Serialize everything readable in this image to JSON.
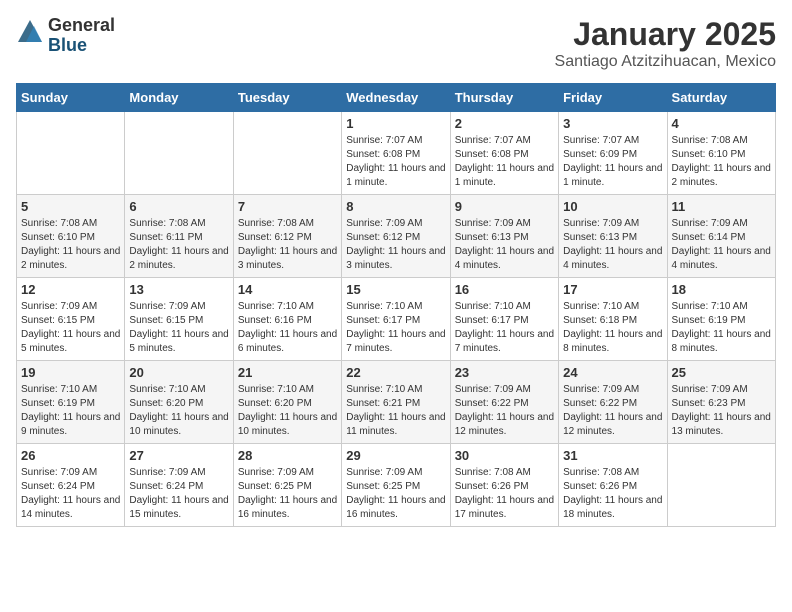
{
  "logo": {
    "general": "General",
    "blue": "Blue"
  },
  "title": "January 2025",
  "location": "Santiago Atzitzihuacan, Mexico",
  "days_of_week": [
    "Sunday",
    "Monday",
    "Tuesday",
    "Wednesday",
    "Thursday",
    "Friday",
    "Saturday"
  ],
  "weeks": [
    [
      {
        "day": "",
        "info": ""
      },
      {
        "day": "",
        "info": ""
      },
      {
        "day": "",
        "info": ""
      },
      {
        "day": "1",
        "sunrise": "Sunrise: 7:07 AM",
        "sunset": "Sunset: 6:08 PM",
        "daylight": "Daylight: 11 hours and 1 minute."
      },
      {
        "day": "2",
        "sunrise": "Sunrise: 7:07 AM",
        "sunset": "Sunset: 6:08 PM",
        "daylight": "Daylight: 11 hours and 1 minute."
      },
      {
        "day": "3",
        "sunrise": "Sunrise: 7:07 AM",
        "sunset": "Sunset: 6:09 PM",
        "daylight": "Daylight: 11 hours and 1 minute."
      },
      {
        "day": "4",
        "sunrise": "Sunrise: 7:08 AM",
        "sunset": "Sunset: 6:10 PM",
        "daylight": "Daylight: 11 hours and 2 minutes."
      }
    ],
    [
      {
        "day": "5",
        "sunrise": "Sunrise: 7:08 AM",
        "sunset": "Sunset: 6:10 PM",
        "daylight": "Daylight: 11 hours and 2 minutes."
      },
      {
        "day": "6",
        "sunrise": "Sunrise: 7:08 AM",
        "sunset": "Sunset: 6:11 PM",
        "daylight": "Daylight: 11 hours and 2 minutes."
      },
      {
        "day": "7",
        "sunrise": "Sunrise: 7:08 AM",
        "sunset": "Sunset: 6:12 PM",
        "daylight": "Daylight: 11 hours and 3 minutes."
      },
      {
        "day": "8",
        "sunrise": "Sunrise: 7:09 AM",
        "sunset": "Sunset: 6:12 PM",
        "daylight": "Daylight: 11 hours and 3 minutes."
      },
      {
        "day": "9",
        "sunrise": "Sunrise: 7:09 AM",
        "sunset": "Sunset: 6:13 PM",
        "daylight": "Daylight: 11 hours and 4 minutes."
      },
      {
        "day": "10",
        "sunrise": "Sunrise: 7:09 AM",
        "sunset": "Sunset: 6:13 PM",
        "daylight": "Daylight: 11 hours and 4 minutes."
      },
      {
        "day": "11",
        "sunrise": "Sunrise: 7:09 AM",
        "sunset": "Sunset: 6:14 PM",
        "daylight": "Daylight: 11 hours and 4 minutes."
      }
    ],
    [
      {
        "day": "12",
        "sunrise": "Sunrise: 7:09 AM",
        "sunset": "Sunset: 6:15 PM",
        "daylight": "Daylight: 11 hours and 5 minutes."
      },
      {
        "day": "13",
        "sunrise": "Sunrise: 7:09 AM",
        "sunset": "Sunset: 6:15 PM",
        "daylight": "Daylight: 11 hours and 5 minutes."
      },
      {
        "day": "14",
        "sunrise": "Sunrise: 7:10 AM",
        "sunset": "Sunset: 6:16 PM",
        "daylight": "Daylight: 11 hours and 6 minutes."
      },
      {
        "day": "15",
        "sunrise": "Sunrise: 7:10 AM",
        "sunset": "Sunset: 6:17 PM",
        "daylight": "Daylight: 11 hours and 7 minutes."
      },
      {
        "day": "16",
        "sunrise": "Sunrise: 7:10 AM",
        "sunset": "Sunset: 6:17 PM",
        "daylight": "Daylight: 11 hours and 7 minutes."
      },
      {
        "day": "17",
        "sunrise": "Sunrise: 7:10 AM",
        "sunset": "Sunset: 6:18 PM",
        "daylight": "Daylight: 11 hours and 8 minutes."
      },
      {
        "day": "18",
        "sunrise": "Sunrise: 7:10 AM",
        "sunset": "Sunset: 6:19 PM",
        "daylight": "Daylight: 11 hours and 8 minutes."
      }
    ],
    [
      {
        "day": "19",
        "sunrise": "Sunrise: 7:10 AM",
        "sunset": "Sunset: 6:19 PM",
        "daylight": "Daylight: 11 hours and 9 minutes."
      },
      {
        "day": "20",
        "sunrise": "Sunrise: 7:10 AM",
        "sunset": "Sunset: 6:20 PM",
        "daylight": "Daylight: 11 hours and 10 minutes."
      },
      {
        "day": "21",
        "sunrise": "Sunrise: 7:10 AM",
        "sunset": "Sunset: 6:20 PM",
        "daylight": "Daylight: 11 hours and 10 minutes."
      },
      {
        "day": "22",
        "sunrise": "Sunrise: 7:10 AM",
        "sunset": "Sunset: 6:21 PM",
        "daylight": "Daylight: 11 hours and 11 minutes."
      },
      {
        "day": "23",
        "sunrise": "Sunrise: 7:09 AM",
        "sunset": "Sunset: 6:22 PM",
        "daylight": "Daylight: 11 hours and 12 minutes."
      },
      {
        "day": "24",
        "sunrise": "Sunrise: 7:09 AM",
        "sunset": "Sunset: 6:22 PM",
        "daylight": "Daylight: 11 hours and 12 minutes."
      },
      {
        "day": "25",
        "sunrise": "Sunrise: 7:09 AM",
        "sunset": "Sunset: 6:23 PM",
        "daylight": "Daylight: 11 hours and 13 minutes."
      }
    ],
    [
      {
        "day": "26",
        "sunrise": "Sunrise: 7:09 AM",
        "sunset": "Sunset: 6:24 PM",
        "daylight": "Daylight: 11 hours and 14 minutes."
      },
      {
        "day": "27",
        "sunrise": "Sunrise: 7:09 AM",
        "sunset": "Sunset: 6:24 PM",
        "daylight": "Daylight: 11 hours and 15 minutes."
      },
      {
        "day": "28",
        "sunrise": "Sunrise: 7:09 AM",
        "sunset": "Sunset: 6:25 PM",
        "daylight": "Daylight: 11 hours and 16 minutes."
      },
      {
        "day": "29",
        "sunrise": "Sunrise: 7:09 AM",
        "sunset": "Sunset: 6:25 PM",
        "daylight": "Daylight: 11 hours and 16 minutes."
      },
      {
        "day": "30",
        "sunrise": "Sunrise: 7:08 AM",
        "sunset": "Sunset: 6:26 PM",
        "daylight": "Daylight: 11 hours and 17 minutes."
      },
      {
        "day": "31",
        "sunrise": "Sunrise: 7:08 AM",
        "sunset": "Sunset: 6:26 PM",
        "daylight": "Daylight: 11 hours and 18 minutes."
      },
      {
        "day": "",
        "info": ""
      }
    ]
  ]
}
